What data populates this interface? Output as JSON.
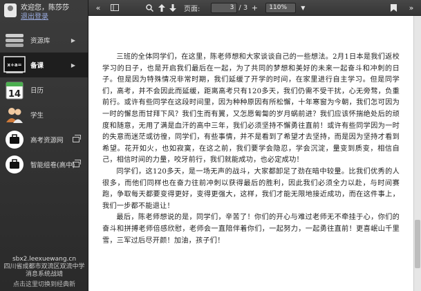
{
  "user": {
    "greeting": "欢迎您，陈莎莎",
    "logout": "退出登录"
  },
  "nav": [
    {
      "label": "资源库",
      "icon": "resource-icon"
    },
    {
      "label": "备课",
      "icon": "lesson-prep-icon"
    },
    {
      "label": "日历",
      "icon": "calendar-icon",
      "calendar_day": "14"
    },
    {
      "label": "学生",
      "icon": "students-icon"
    },
    {
      "label": "高考资源网",
      "icon": "briefcase-icon"
    },
    {
      "label": "智能组卷(高中)",
      "icon": "briefcase-icon"
    }
  ],
  "footer": {
    "site": "sbx2.leexuewang.cn",
    "school_line1": "四川省成都市双流区双流中学",
    "school_line2": "消息系统战靖",
    "switch": "点击这里切换到经典新"
  },
  "toolbar": {
    "page_label": "页面:",
    "page_value": "3",
    "page_total": "/ 3",
    "zoom_value": "110%"
  },
  "document": {
    "paragraphs": [
      "三班的全体同学们，在这里，陈老师想和大家谈谈自己的一些想法。2月1日本是我们返校学习的日子，也是开启我们最后在一起，为了共同的梦想和美好的未来一起奋斗和冲刺的日子。但是因为特殊情况非常时期，我们延缓了开学的时间，在家里进行自主学习。但是同学们，高考，并不会因此而延缓，距离高考只有120多天，我们仍需不受干扰，心无旁骛，负重前行。或许有些同学在这段时间里，因为种种原因有所松懈，十年寒窗为今朝，我们怎可因为一时的懈怠而甘拜下风？我们生而有翼，又怎愿匍匐的岁月蜗前进？我们应该怀揣绝处后的顽度和随意，无用了满是血汗的高中三年，我们必须坚持不懈勇往直前！或许有些同学因为一时的失意而迷茫或彷徨，同学们，有些事情，并不是看到了希望才去坚持，而是因为坚持才看到希望。花开如火，也如寂寞，在这之前，我们要学会隐忍，学会沉淀，量变到质变，相信自己，相信时间的力量，咬牙前行，我们就能成功，也必定成功！",
      "同学们，这120多天，是一场无声的战斗，大家都卸足了劲在暗中较量。比我们优秀的人很多，而他们同样也在奋力往前冲刺以获得最后的胜利，因此我们必须全力以赴，与时间赛跑，争取每天都要变得更好，变得更强大，这样，我们才能无限地接近成功，而在这件事上，我们一步都不能退让！",
      "最后，陈老师想说的是，同学们，辛苦了！你们的开心与难过老师无不牵挂于心，你们的奋斗和拼搏老师倍感欣慰，老师会一直陪伴着你们，一起努力，一起勇往直前！更喜岷山千里雪，三军过后尽开颜！加油，孩子们！"
    ]
  }
}
